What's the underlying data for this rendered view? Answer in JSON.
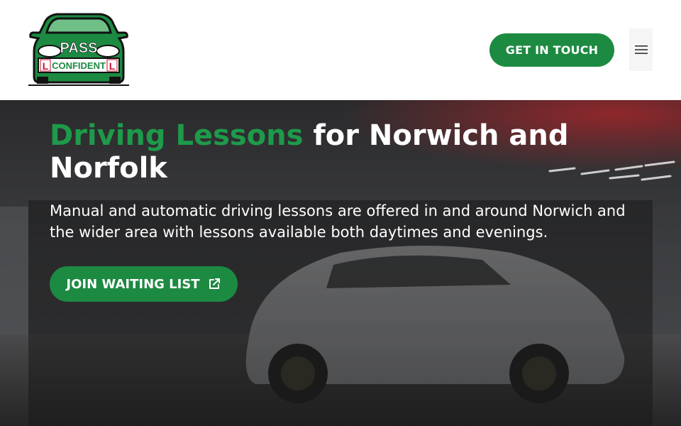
{
  "logo": {
    "line1": "PASS",
    "line2": "CONFIDENT",
    "l_plate": "L"
  },
  "header": {
    "cta_label": "GET IN TOUCH",
    "menu_icon": "hamburger-icon"
  },
  "hero": {
    "title_accent": "Driving Lessons",
    "title_rest": " for Norwich and Norfolk",
    "description": "Manual and automatic driving lessons are offered in and around Norwich and the wider area with lessons available both daytimes and evenings.",
    "button_label": "JOIN WAITING LIST",
    "button_icon": "external-link-icon"
  },
  "colors": {
    "brand_green": "#1d8a42",
    "accent_text_green": "#1e9a4a",
    "white": "#ffffff"
  }
}
